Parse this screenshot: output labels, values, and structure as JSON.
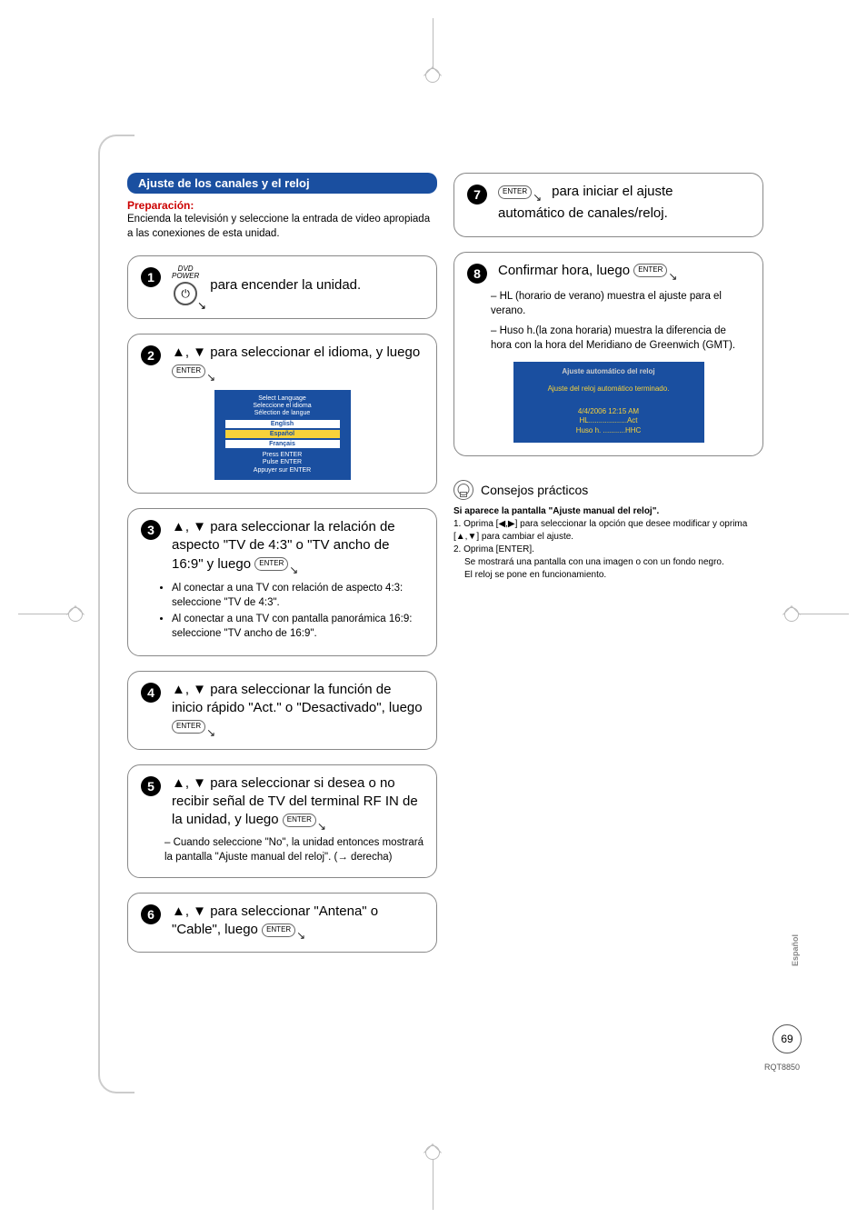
{
  "header": {
    "title": "Ajuste de los canales y el reloj",
    "prepLabel": "Preparación:",
    "prepText": "Encienda la televisión y seleccione la entrada de video apropiada a las conexiones de esta unidad."
  },
  "steps": {
    "s1": {
      "dvd": "DVD",
      "power": "POWER",
      "text": "para encender la unidad."
    },
    "s2": {
      "line1": "▲, ▼ para seleccionar el idioma, y luego",
      "enter": "ENTER"
    },
    "s3": {
      "text": "▲, ▼ para seleccionar la relación de aspecto \"TV de 4:3\" o \"TV ancho de 16:9\" y luego",
      "enter": "ENTER",
      "b1": "Al conectar a una TV con relación de aspecto 4:3: seleccione \"TV de 4:3\".",
      "b2": "Al conectar a una TV con pantalla panorámica 16:9: seleccione \"TV ancho de 16:9\"."
    },
    "s4": {
      "text": "▲, ▼ para seleccionar la función de inicio rápido \"Act.\" o \"Desactivado\", luego",
      "enter": "ENTER"
    },
    "s5": {
      "text": "▲, ▼ para seleccionar si desea o no recibir señal de TV del terminal RF IN de la unidad, y luego",
      "enter": "ENTER",
      "dash": "– Cuando seleccione \"No\", la unidad entonces mostrará la pantalla \"Ajuste manual del reloj\". (→ derecha)"
    },
    "s6": {
      "text": "▲, ▼ para seleccionar \"Antena\" o \"Cable\", luego",
      "enter": "ENTER"
    },
    "s7": {
      "enter": "ENTER",
      "text1": "para iniciar el ajuste",
      "text2": "automático de canales/reloj."
    },
    "s8": {
      "text": "Confirmar hora, luego",
      "enter": "ENTER",
      "d1": "– HL (horario de verano) muestra el ajuste para el verano.",
      "d2": "– Huso h.(la zona horaria) muestra la diferencia de hora con la hora del Meridiano de Greenwich (GMT)."
    }
  },
  "langMenu": {
    "t1": "Select Language",
    "t2": "Seleccione el idioma",
    "t3": "Sélection de langue",
    "o1": "English",
    "o2": "Español",
    "o3": "Français",
    "f1": "Press ENTER",
    "f2": "Pulse ENTER",
    "f3": "Appuyer sur ENTER"
  },
  "autoClock": {
    "title": "Ajuste automático del reloj",
    "msg": "Ajuste del reloj automático terminado.",
    "date": "4/4/2006    12:15 AM",
    "hl": "HL...................Act",
    "huso": "Huso h. ...........HHC"
  },
  "tips": {
    "title": "Consejos prácticos",
    "bold": "Si aparece la pantalla \"Ajuste manual del reloj\".",
    "l1a": "1. Oprima [◀,▶] para seleccionar la opción que desee modificar y oprima [▲,▼] para cambiar el ajuste.",
    "l2": "2. Oprima [ENTER].",
    "l3": "Se mostrará una pantalla con una imagen o con un fondo negro.",
    "l4": "El reloj se pone en funcionamiento."
  },
  "footer": {
    "lang": "Español",
    "page": "69",
    "doc": "RQT8850"
  }
}
